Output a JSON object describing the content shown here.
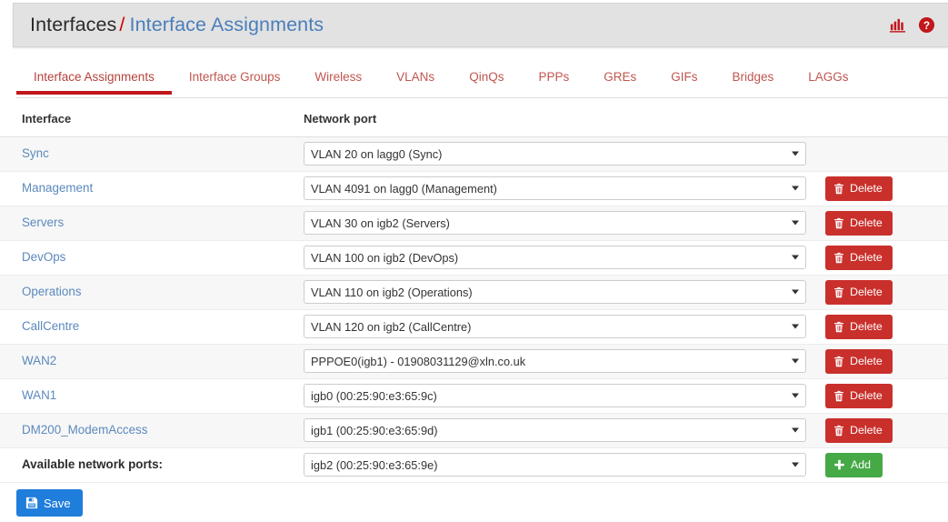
{
  "header": {
    "breadcrumb_root": "Interfaces",
    "breadcrumb_separator": "/",
    "breadcrumb_current": "Interface Assignments",
    "icons": [
      {
        "name": "stats-chart-icon",
        "label": "Status Monitoring"
      },
      {
        "name": "help-circle-icon",
        "label": "Help"
      }
    ],
    "accent_red": "#c1161c",
    "link_blue": "#5b89bd"
  },
  "tabs": [
    {
      "label": "Interface Assignments",
      "active": true
    },
    {
      "label": "Interface Groups",
      "active": false
    },
    {
      "label": "Wireless",
      "active": false
    },
    {
      "label": "VLANs",
      "active": false
    },
    {
      "label": "QinQs",
      "active": false
    },
    {
      "label": "PPPs",
      "active": false
    },
    {
      "label": "GREs",
      "active": false
    },
    {
      "label": "GIFs",
      "active": false
    },
    {
      "label": "Bridges",
      "active": false
    },
    {
      "label": "LAGGs",
      "active": false
    }
  ],
  "table": {
    "columns": [
      "Interface",
      "Network port"
    ],
    "rows": [
      {
        "interface": "Sync",
        "port": "VLAN 20 on lagg0 (Sync)",
        "deletable": false
      },
      {
        "interface": "Management",
        "port": "VLAN 4091 on lagg0 (Management)",
        "deletable": true
      },
      {
        "interface": "Servers",
        "port": "VLAN 30 on igb2 (Servers)",
        "deletable": true
      },
      {
        "interface": "DevOps",
        "port": "VLAN 100 on igb2 (DevOps)",
        "deletable": true
      },
      {
        "interface": "Operations",
        "port": "VLAN 110 on igb2 (Operations)",
        "deletable": true
      },
      {
        "interface": "CallCentre",
        "port": "VLAN 120 on igb2 (CallCentre)",
        "deletable": true
      },
      {
        "interface": "WAN2",
        "port": "PPPOE0(igb1) - 01908031129@xln.co.uk",
        "deletable": true
      },
      {
        "interface": "WAN1",
        "port": "igb0 (00:25:90:e3:65:9c)",
        "deletable": true
      },
      {
        "interface": "DM200_ModemAccess",
        "port": "igb1 (00:25:90:e3:65:9d)",
        "deletable": true
      }
    ],
    "available_row": {
      "label": "Available network ports:",
      "port": "igb2 (00:25:90:e3:65:9e)"
    }
  },
  "buttons": {
    "delete_label": "Delete",
    "add_label": "Add",
    "save_label": "Save",
    "delete_color": "#c9302c",
    "add_color": "#45a945",
    "save_color": "#1f7ddb"
  }
}
